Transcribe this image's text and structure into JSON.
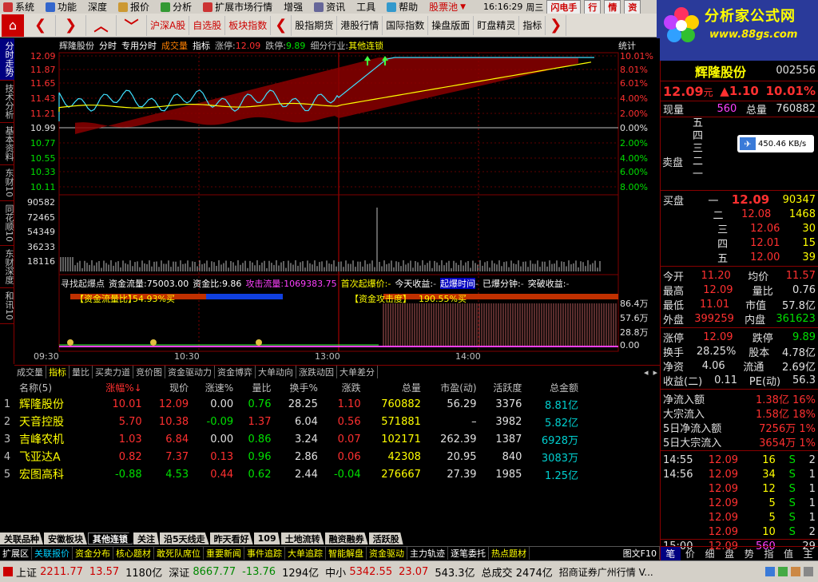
{
  "menu": {
    "items": [
      "系统",
      "功能",
      "深度",
      "报价",
      "分析",
      "扩展市场行情",
      "增强",
      "资讯",
      "工具",
      "帮助",
      "股票池"
    ]
  },
  "clock": {
    "time": "16:16:29",
    "weekday": "周三",
    "flash": "闪电手",
    "tab1": "行",
    "tab2": "情",
    "tab3": "资"
  },
  "toolbar": {
    "buttons": [
      "沪深A股",
      "自选股",
      "板块指数",
      "股指期货",
      "港股行情",
      "国际指数",
      "操盘版面",
      "盯盘精灵",
      "指标"
    ]
  },
  "logo": {
    "title": "分析家公式网",
    "url": "www.88gs.com"
  },
  "lefttabs": [
    "分时走势",
    "技术分析",
    "基本资料",
    "东财10",
    "同花顺10",
    "东财深度",
    "和讯10"
  ],
  "chart": {
    "head": {
      "name": "辉隆股份",
      "mode": "分时",
      "mode2": "专用分时",
      "ind": "成交量",
      "ind2": "指标",
      "up_label": "涨停:",
      "up_val": "12.09",
      "down_label": "跌停:",
      "down_val": "9.89",
      "sector_label": "细分行业:",
      "sector_val": "其他连锁",
      "stat": "统计"
    },
    "price_left": [
      "12.09",
      "11.87",
      "11.65",
      "11.43",
      "11.21",
      "10.99",
      "10.77",
      "10.55",
      "10.33",
      "10.11"
    ],
    "price_right": [
      "10.01%",
      "8.01%",
      "6.01%",
      "4.00%",
      "2.00%",
      "0.00%",
      "2.00%",
      "4.00%",
      "6.00%",
      "8.00%"
    ],
    "vol_left": [
      "90582",
      "72465",
      "54349",
      "36233",
      "18116"
    ],
    "ind_right": [
      "86.4万",
      "57.6万",
      "28.8万",
      "0.00"
    ],
    "ind_head": {
      "t1": "寻找起爆点",
      "t2": "资金流量:",
      "v2": "75003.00",
      "t3": "资金比:",
      "v3": "9.86",
      "t4": "攻击流量:",
      "v4": "1069383.75",
      "t5": "首次起爆价:",
      "v5": "-",
      "t6": "今天收益:",
      "v6": "-",
      "t7": "起爆时间",
      "v7": "-",
      "t8": "已爆分钟:",
      "v8": "-",
      "t9": "突破收益:",
      "v9": "-"
    },
    "ind_sub": {
      "a": "【资金流量比】",
      "av": "54.93%买",
      "b": "【资金攻击度】",
      "bv": "190.55%买"
    },
    "times": [
      "09:30",
      "10:30",
      "13:00",
      "14:00"
    ]
  },
  "chartbtm": [
    "成交量",
    "指标",
    "量比",
    "买卖力道",
    "竞价图",
    "资金驱动力",
    "资金博弈",
    "大单动向",
    "涨跌动因",
    "大单差分"
  ],
  "list": {
    "headers": [
      "名称(5)",
      "涨幅%↓",
      "现价",
      "涨速%",
      "量比",
      "换手%",
      "涨跌",
      "总量",
      "市盈(动)",
      "活跃度",
      "总金额"
    ],
    "rows": [
      {
        "idx": "1",
        "name": "辉隆股份",
        "chg": "10.01",
        "price": "12.09",
        "speed": "0.00",
        "vr": "0.76",
        "turn": "28.25",
        "diff": "1.10",
        "vol": "760882",
        "pe": "56.29",
        "act": "3376",
        "amt": "8.81亿"
      },
      {
        "idx": "2",
        "name": "天音控股",
        "chg": "5.70",
        "price": "10.38",
        "speed": "-0.09",
        "vr": "1.37",
        "turn": "6.04",
        "diff": "0.56",
        "vol": "571881",
        "pe": "–",
        "act": "3982",
        "amt": "5.82亿"
      },
      {
        "idx": "3",
        "name": "吉峰农机",
        "chg": "1.03",
        "price": "6.84",
        "speed": "0.00",
        "vr": "0.86",
        "turn": "3.24",
        "diff": "0.07",
        "vol": "102171",
        "pe": "262.39",
        "act": "1387",
        "amt": "6928万"
      },
      {
        "idx": "4",
        "name": "飞亚达A",
        "chg": "0.82",
        "price": "7.37",
        "speed": "0.13",
        "vr": "0.96",
        "turn": "2.86",
        "diff": "0.06",
        "vol": "42308",
        "pe": "20.95",
        "act": "840",
        "amt": "3083万"
      },
      {
        "idx": "5",
        "name": "宏图高科",
        "chg": "-0.88",
        "price": "4.53",
        "speed": "0.44",
        "vr": "0.62",
        "turn": "2.44",
        "diff": "-0.04",
        "vol": "276667",
        "pe": "27.39",
        "act": "1985",
        "amt": "1.25亿"
      }
    ]
  },
  "bottabs": [
    "关联品种",
    "安徽板块",
    "其他连锁",
    "关注",
    "沿5天线走",
    "昨天看好",
    "109",
    "土地流转",
    "融资融券",
    "活跃股"
  ],
  "navbar": [
    "扩展区",
    "关联报价",
    "资金分布",
    "核心题材",
    "敢死队席位",
    "重要新闻",
    "事件追踪",
    "大单追踪",
    "智能解盘",
    "资金驱动",
    "主力轨迹",
    "逐笔委托",
    "热点题材",
    "图文F10"
  ],
  "status": {
    "sh_label": "上证",
    "sh_val": "2211.77",
    "sh_chg": "13.57",
    "sh_amt": "1180亿",
    "sz_label": "深证",
    "sz_val": "8667.77",
    "sz_chg": "-13.76",
    "sz_amt": "1294亿",
    "zx_label": "中小",
    "zx_val": "5342.55",
    "zx_chg": "23.07",
    "zx_amt": "543.3亿",
    "tot_label": "总成交",
    "tot_val": "2474亿",
    "broker": "招商证券广州行情 V..."
  },
  "right": {
    "title": "辉隆股份",
    "code": "002556",
    "price": "12.09",
    "unit": "元",
    "chg": "▲1.10",
    "pct": "10.01%",
    "now_label": "现量",
    "now_val": "560",
    "tot_label": "总量",
    "tot_val": "760882",
    "sell": [
      {
        "l": "五",
        "p": "",
        "v": ""
      },
      {
        "l": "四",
        "p": "",
        "v": ""
      },
      {
        "l": "三",
        "p": "",
        "v": ""
      },
      {
        "l": "二",
        "p": "",
        "v": ""
      },
      {
        "l": "一",
        "p": "",
        "v": ""
      }
    ],
    "sell_title": "卖盘",
    "buy_title": "买盘",
    "buy": [
      {
        "l": "一",
        "p": "12.09",
        "v": "90347"
      },
      {
        "l": "二",
        "p": "12.08",
        "v": "1468"
      },
      {
        "l": "三",
        "p": "12.06",
        "v": "30"
      },
      {
        "l": "四",
        "p": "12.01",
        "v": "15"
      },
      {
        "l": "五",
        "p": "12.00",
        "v": "39"
      }
    ],
    "speed": "450.46 KB/s",
    "stats": [
      {
        "a": "今开",
        "av": "11.20",
        "b": "均价",
        "bv": "11.57"
      },
      {
        "a": "最高",
        "av": "12.09",
        "b": "量比",
        "bv": "0.76"
      },
      {
        "a": "最低",
        "av": "11.01",
        "b": "市值",
        "bv": "57.8亿"
      },
      {
        "a": "外盘",
        "av": "399259",
        "b": "内盘",
        "bv": "361623"
      }
    ],
    "stats2": [
      {
        "a": "涨停",
        "av": "12.09",
        "b": "跌停",
        "bv": "9.89"
      },
      {
        "a": "换手",
        "av": "28.25%",
        "b": "股本",
        "bv": "4.78亿"
      },
      {
        "a": "净资",
        "av": "4.06",
        "b": "流通",
        "bv": "2.69亿"
      },
      {
        "a": "收益(二)",
        "av": "0.11",
        "b": "PE(动)",
        "bv": "56.3"
      }
    ],
    "flows": [
      {
        "l": "净流入额",
        "v": "1.38亿",
        "p": "16%"
      },
      {
        "l": "大宗流入",
        "v": "1.58亿",
        "p": "18%"
      },
      {
        "l": "5日净流入额",
        "v": "7256万",
        "p": "1%"
      },
      {
        "l": "5日大宗流入",
        "v": "3654万",
        "p": "1%"
      }
    ],
    "ticks": [
      {
        "t": "14:55",
        "p": "12.09",
        "v": "16",
        "s": "S",
        "n": "2"
      },
      {
        "t": "14:56",
        "p": "12.09",
        "v": "34",
        "s": "S",
        "n": "1"
      },
      {
        "t": "",
        "p": "12.09",
        "v": "12",
        "s": "S",
        "n": "1"
      },
      {
        "t": "",
        "p": "12.09",
        "v": "5",
        "s": "S",
        "n": "1"
      },
      {
        "t": "",
        "p": "12.09",
        "v": "5",
        "s": "S",
        "n": "1"
      },
      {
        "t": "",
        "p": "12.09",
        "v": "10",
        "s": "S",
        "n": "2"
      },
      {
        "t": "15:00",
        "p": "12.09",
        "v": "560",
        "s": "",
        "n": "29"
      }
    ],
    "btabs": [
      "笔",
      "价",
      "细",
      "盘",
      "势",
      "指",
      "值",
      "主"
    ]
  }
}
